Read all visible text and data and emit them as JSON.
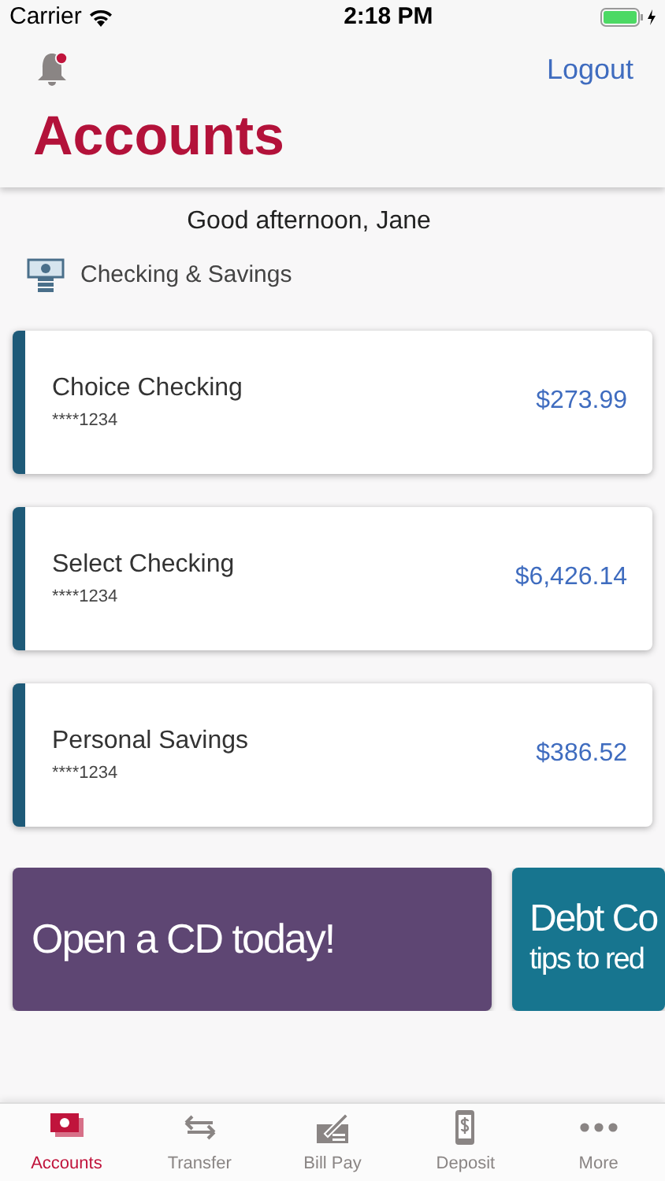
{
  "status_bar": {
    "carrier": "Carrier",
    "time": "2:18 PM",
    "charging": true
  },
  "header": {
    "notifications_unread": true,
    "logout": "Logout",
    "title": "Accounts"
  },
  "greeting": "Good afternoon, Jane",
  "section": {
    "title": "Checking & Savings"
  },
  "accounts": [
    {
      "name": "Choice Checking",
      "number": "****1234",
      "balance": "$273.99"
    },
    {
      "name": "Select Checking",
      "number": "****1234",
      "balance": "$6,426.14"
    },
    {
      "name": "Personal Savings",
      "number": "****1234",
      "balance": "$386.52"
    }
  ],
  "promos": [
    {
      "title": "Open a CD today!",
      "color": "#5e4673"
    },
    {
      "title": "Debt Co",
      "subtitle": "tips to red",
      "color": "#17758f"
    }
  ],
  "tabs": [
    {
      "label": "Accounts",
      "kind": "cash",
      "selected": true
    },
    {
      "label": "Transfer",
      "kind": "transfer",
      "selected": false
    },
    {
      "label": "Bill Pay",
      "kind": "check",
      "selected": false
    },
    {
      "label": "Deposit",
      "kind": "phone",
      "selected": false
    },
    {
      "label": "More",
      "kind": "more",
      "selected": false
    }
  ]
}
